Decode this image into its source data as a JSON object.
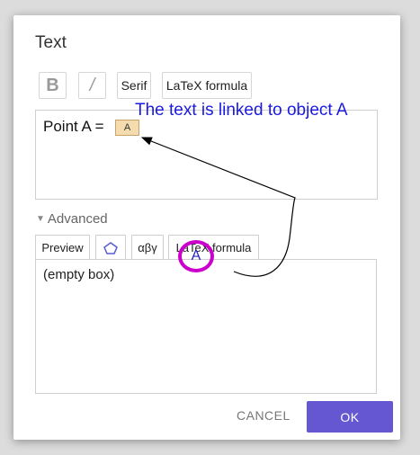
{
  "dialog": {
    "title": "Text",
    "toolbar": {
      "bold_label": "B",
      "italic_label": "/",
      "serif_label": "Serif",
      "latex_label": "LaTeX formula"
    },
    "editor": {
      "text": "Point A =",
      "object_chip": "A"
    },
    "annotation": "The text is linked to object A",
    "advanced": {
      "label": "Advanced",
      "tabs": [
        "Preview",
        "",
        "αβγ",
        "LaTeX formula"
      ],
      "preview_text": "(empty box)",
      "preview_object": "A"
    },
    "buttons": {
      "cancel": "CANCEL",
      "ok": "OK"
    }
  },
  "colors": {
    "accent": "#6557d2",
    "annotation": "#1a1ae0",
    "highlight_circle": "#cc00cc",
    "chip": "#f5dcaf"
  },
  "icons": {
    "geometry_tab": "pentagon-icon",
    "collapse": "triangle-down-icon"
  }
}
